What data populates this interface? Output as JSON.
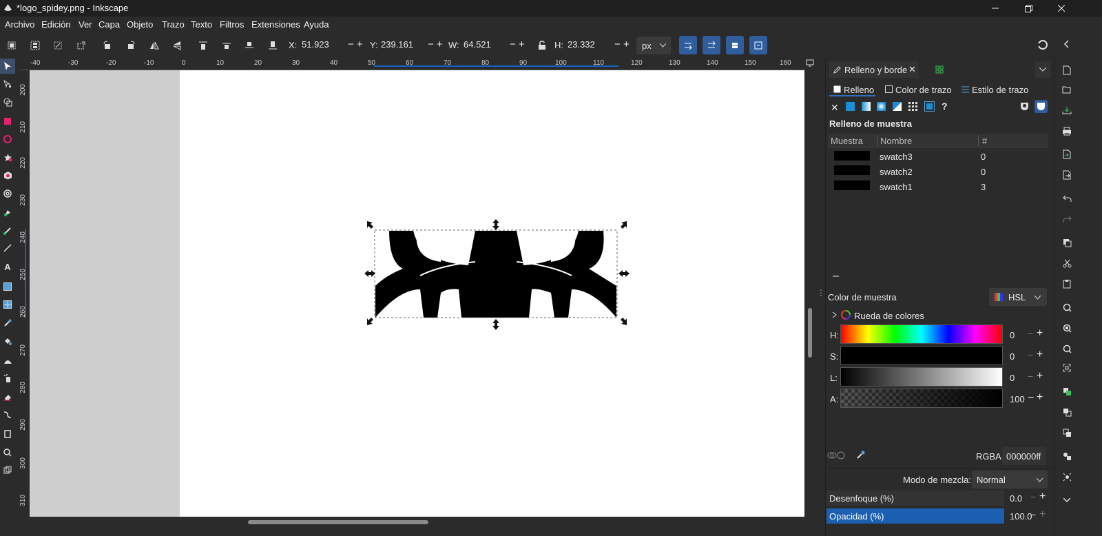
{
  "window": {
    "title": "*logo_spidey.png - Inkscape"
  },
  "menu": [
    "Archivo",
    "Edición",
    "Ver",
    "Capa",
    "Objeto",
    "Trazo",
    "Texto",
    "Filtros",
    "Extensiones",
    "Ayuda"
  ],
  "toolbar": {
    "x_label": "X:",
    "x_value": "51.923",
    "y_label": "Y:",
    "y_value": "239.161",
    "w_label": "W:",
    "w_value": "64.521",
    "h_label": "H:",
    "h_value": "23.332",
    "unit": "px"
  },
  "ruler": {
    "h_ticks": [
      "-40",
      "-30",
      "-20",
      "-10",
      "0",
      "10",
      "20",
      "30",
      "40",
      "50",
      "60",
      "70",
      "80",
      "90",
      "100",
      "110",
      "120",
      "130",
      "140",
      "150",
      "160"
    ],
    "v_ticks": [
      "200",
      "210",
      "220",
      "230",
      "240",
      "250",
      "260",
      "270",
      "280",
      "290",
      "300",
      "310"
    ]
  },
  "panel": {
    "tab_title": "Relleno y borde",
    "subtabs": {
      "fill": "Relleno",
      "stroke_paint": "Color de trazo",
      "stroke_style": "Estilo de trazo"
    },
    "section_title": "Relleno de muestra",
    "table_headers": {
      "swatch": "Muestra",
      "name": "Nombre",
      "count": "#"
    },
    "swatches": [
      {
        "name": "swatch3",
        "count": "0",
        "color": "#000000"
      },
      {
        "name": "swatch2",
        "count": "0",
        "color": "#000000"
      },
      {
        "name": "swatch1",
        "count": "3",
        "color": "#000000"
      }
    ],
    "minus_label": "–",
    "swatch_color_label": "Color de muestra",
    "color_mode": "HSL",
    "color_wheel_label": "Rueda de colores",
    "h_label": "H:",
    "h_value": "0",
    "s_label": "S:",
    "s_value": "0",
    "l_label": "L:",
    "l_value": "0",
    "a_label": "A:",
    "a_value": "100",
    "rgba_label": "RGBA:",
    "rgba_value": "000000ff",
    "blend_label": "Modo de mezcla:",
    "blend_value": "Normal",
    "blur_label": "Desenfoque (%)",
    "blur_value": "0.0",
    "opacity_label": "Opacidad (%)",
    "opacity_value": "100.0"
  },
  "colors": {
    "accent": "#2f5d9e",
    "selection_blue": "#1565c0"
  }
}
